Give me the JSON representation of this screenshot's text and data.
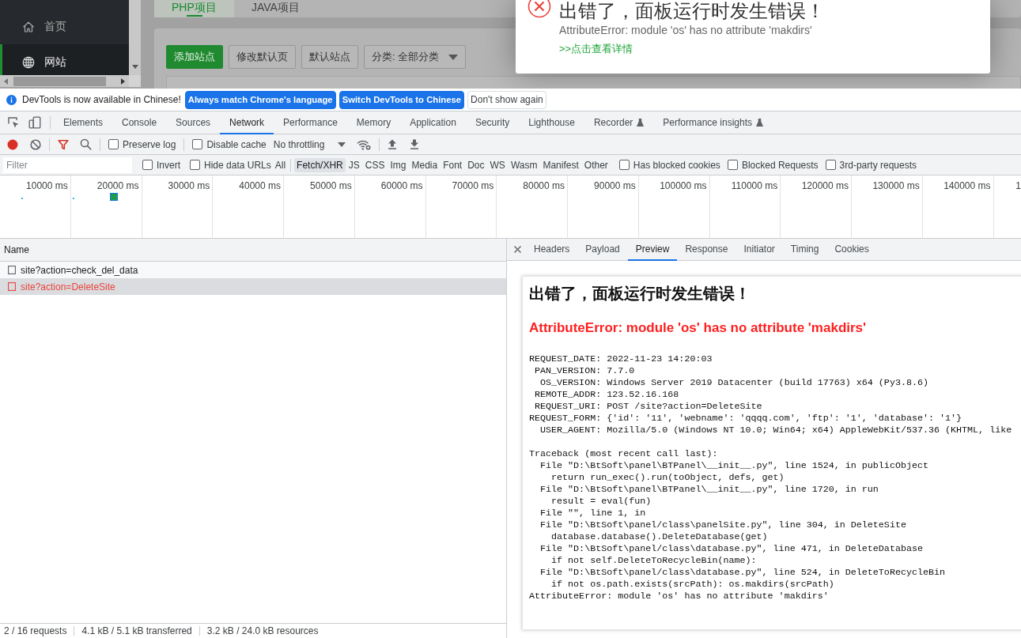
{
  "site": {
    "sidebar": [
      {
        "label": "首页",
        "selected": false
      },
      {
        "label": "网站",
        "selected": true
      }
    ],
    "tabs": [
      {
        "label": "PHP项目",
        "selected": true
      },
      {
        "label": "JAVA项目",
        "selected": false
      }
    ],
    "buttons": [
      {
        "label": "添加站点",
        "kind": "primary"
      },
      {
        "label": "修改默认页",
        "kind": "default"
      },
      {
        "label": "默认站点",
        "kind": "default"
      },
      {
        "label": "分类: 全部分类",
        "kind": "dropdown"
      }
    ]
  },
  "error_message": {
    "title": "出错了，面板运行时发生错误！",
    "message": "AttributeError: module 'os' has no attribute 'makdirs'",
    "link": ">>点击查看详情"
  },
  "devtools": {
    "infobar": {
      "text": "DevTools is now available in Chinese!",
      "buttons": [
        {
          "label": "Always match Chrome's language",
          "kind": "primary"
        },
        {
          "label": "Switch DevTools to Chinese",
          "kind": "primary"
        },
        {
          "label": "Don't show again",
          "kind": "default"
        }
      ]
    },
    "tabs": [
      {
        "label": "Elements",
        "selected": false,
        "experimental": false
      },
      {
        "label": "Console",
        "selected": false,
        "experimental": false
      },
      {
        "label": "Sources",
        "selected": false,
        "experimental": false
      },
      {
        "label": "Network",
        "selected": true,
        "experimental": false
      },
      {
        "label": "Performance",
        "selected": false,
        "experimental": false
      },
      {
        "label": "Memory",
        "selected": false,
        "experimental": false
      },
      {
        "label": "Application",
        "selected": false,
        "experimental": false
      },
      {
        "label": "Security",
        "selected": false,
        "experimental": false
      },
      {
        "label": "Lighthouse",
        "selected": false,
        "experimental": false
      },
      {
        "label": "Recorder",
        "selected": false,
        "experimental": true
      },
      {
        "label": "Performance insights",
        "selected": false,
        "experimental": true
      }
    ],
    "toolbar": {
      "recording": true,
      "preserve_log": {
        "label": "Preserve log",
        "checked": false
      },
      "disable_cache": {
        "label": "Disable cache",
        "checked": false
      },
      "throttling": "No throttling"
    },
    "filter_bar": {
      "placeholder": "Filter",
      "invert": {
        "label": "Invert",
        "checked": false
      },
      "hide_data_urls": {
        "label": "Hide data URLs",
        "checked": false
      },
      "types": [
        {
          "label": "All",
          "selected": false
        },
        {
          "label": "Fetch/XHR",
          "selected": true
        },
        {
          "label": "JS",
          "selected": false
        },
        {
          "label": "CSS",
          "selected": false
        },
        {
          "label": "Img",
          "selected": false
        },
        {
          "label": "Media",
          "selected": false
        },
        {
          "label": "Font",
          "selected": false
        },
        {
          "label": "Doc",
          "selected": false
        },
        {
          "label": "WS",
          "selected": false
        },
        {
          "label": "Wasm",
          "selected": false
        },
        {
          "label": "Manifest",
          "selected": false
        },
        {
          "label": "Other",
          "selected": false
        }
      ],
      "options": [
        {
          "label": "Has blocked cookies",
          "checked": false
        },
        {
          "label": "Blocked Requests",
          "checked": false
        },
        {
          "label": "3rd-party requests",
          "checked": false
        }
      ]
    },
    "overview": {
      "ticks": [
        "10000 ms",
        "20000 ms",
        "30000 ms",
        "40000 ms",
        "50000 ms",
        "60000 ms",
        "70000 ms",
        "80000 ms",
        "90000 ms",
        "100000 ms",
        "110000 ms",
        "120000 ms",
        "130000 ms",
        "140000 ms",
        "1"
      ]
    },
    "requests": {
      "column": "Name",
      "rows": [
        {
          "name": "site?action=check_del_data",
          "selected": false,
          "failed": false
        },
        {
          "name": "site?action=DeleteSite",
          "selected": true,
          "failed": true
        }
      ]
    },
    "details": {
      "tabs": [
        {
          "label": "Headers",
          "selected": false
        },
        {
          "label": "Payload",
          "selected": false
        },
        {
          "label": "Preview",
          "selected": true
        },
        {
          "label": "Response",
          "selected": false
        },
        {
          "label": "Initiator",
          "selected": false
        },
        {
          "label": "Timing",
          "selected": false
        },
        {
          "label": "Cookies",
          "selected": false
        }
      ],
      "preview": {
        "title": "出错了，面板运行时发生错误！",
        "error": "AttributeError: module 'os' has no attribute 'makdirs'",
        "info_lines": [
          "REQUEST_DATE: 2022-11-23 14:20:03",
          " PAN_VERSION: 7.7.0",
          "  OS_VERSION: Windows Server 2019 Datacenter (build 17763) x64 (Py3.8.6)",
          " REMOTE_ADDR: 123.52.16.168",
          " REQUEST_URI: POST /site?action=DeleteSite",
          "REQUEST_FORM: {'id': '11', 'webname': 'qqqq.com', 'ftp': '1', 'database': '1'}",
          "  USER_AGENT: Mozilla/5.0 (Windows NT 10.0; Win64; x64) AppleWebKit/537.36 (KHTML, like"
        ],
        "traceback_lines": [
          "Traceback (most recent call last):",
          "  File \"D:\\BtSoft\\panel\\BTPanel\\__init__.py\", line 1524, in publicObject",
          "    return run_exec().run(toObject, defs, get)",
          "  File \"D:\\BtSoft\\panel\\BTPanel\\__init__.py\", line 1720, in run",
          "    result = eval(fun)",
          "  File \"\", line 1, in",
          "  File \"D:\\BtSoft\\panel/class\\panelSite.py\", line 304, in DeleteSite",
          "    database.database().DeleteDatabase(get)",
          "  File \"D:\\BtSoft\\panel/class\\database.py\", line 471, in DeleteDatabase",
          "    if not self.DeleteToRecycleBin(name):",
          "  File \"D:\\BtSoft\\panel/class\\database.py\", line 524, in DeleteToRecycleBin",
          "    if not os.path.exists(srcPath): os.makdirs(srcPath)",
          "AttributeError: module 'os' has no attribute 'makdirs'"
        ]
      }
    },
    "status_bar": [
      "2 / 16 requests",
      "4.1 kB / 5.1 kB transferred",
      "3.2 kB / 24.0 kB resources"
    ]
  }
}
